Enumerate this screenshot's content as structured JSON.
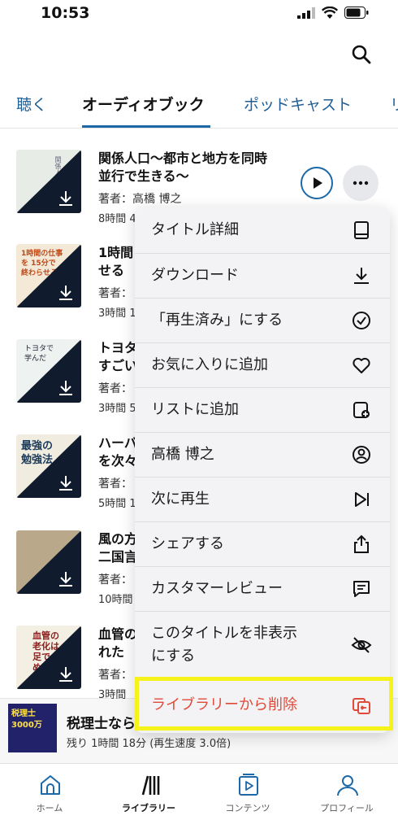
{
  "status_bar": {
    "time": "10:53"
  },
  "tabs": [
    {
      "label": "聴く"
    },
    {
      "label": "オーディオブック"
    },
    {
      "label": "ポッドキャスト"
    },
    {
      "label": "リ"
    }
  ],
  "books": [
    {
      "title": "関係人口〜都市と地方を同時\n並行で生きる〜",
      "author": "著者：高橋 博之",
      "duration": "8時間 4"
    },
    {
      "title": "1時間\nせる",
      "author": "著者：",
      "duration": "3時間 1"
    },
    {
      "title": "トヨタ\nすごい",
      "author": "著者：",
      "duration": "3時間 5"
    },
    {
      "title": "ハーバ\nを次々",
      "author": "著者：",
      "duration": "5時間 1"
    },
    {
      "title": "風の方\n二国言",
      "author": "著者：",
      "duration": "10時間"
    },
    {
      "title": "血管の\nれた",
      "author": "著者：",
      "duration": "3時間"
    }
  ],
  "covers": [
    {
      "title_text": "関係人口"
    },
    {
      "title_text": "1時間の仕事を 15分で 終わらせる"
    },
    {
      "title_text": "トヨタで学んだ"
    },
    {
      "title_text": "最強の 勉強法"
    },
    {
      "title_text": ""
    },
    {
      "title_text": "血管の 老化は 足で止められる"
    }
  ],
  "context_menu": {
    "items": [
      {
        "label": "タイトル詳細",
        "icon": "book-detail-icon"
      },
      {
        "label": "ダウンロード",
        "icon": "download-icon"
      },
      {
        "label": "「再生済み」にする",
        "icon": "check-circle-icon"
      },
      {
        "label": "お気に入りに追加",
        "icon": "heart-icon"
      },
      {
        "label": "リストに追加",
        "icon": "add-to-list-icon"
      },
      {
        "label": "高橋 博之",
        "icon": "person-icon"
      },
      {
        "label": "次に再生",
        "icon": "play-next-icon"
      },
      {
        "label": "シェアする",
        "icon": "share-icon"
      },
      {
        "label": "カスタマーレビュー",
        "icon": "review-icon"
      },
      {
        "label": "このタイトルを非表示\nにする",
        "icon": "hide-icon"
      },
      {
        "label": "ライブラリーから削除",
        "icon": "remove-from-library-icon",
        "color": "#e04a3a"
      }
    ]
  },
  "mini_player": {
    "cover_text": "税理士 3000万",
    "title": "税理士なら",
    "subtitle": "残り 1時間 18分 (再生速度 3.0倍)"
  },
  "tabbar": [
    {
      "label": "ホーム",
      "icon": "home-icon"
    },
    {
      "label": "ライブラリー",
      "icon": "library-icon"
    },
    {
      "label": "コンテンツ",
      "icon": "content-icon"
    },
    {
      "label": "プロフィール",
      "icon": "profile-icon"
    }
  ],
  "colors": {
    "accent": "#1d68a6",
    "destructive": "#e04a3a",
    "highlight": "#f5f21c",
    "menu_bg": "#f3f3f5"
  }
}
